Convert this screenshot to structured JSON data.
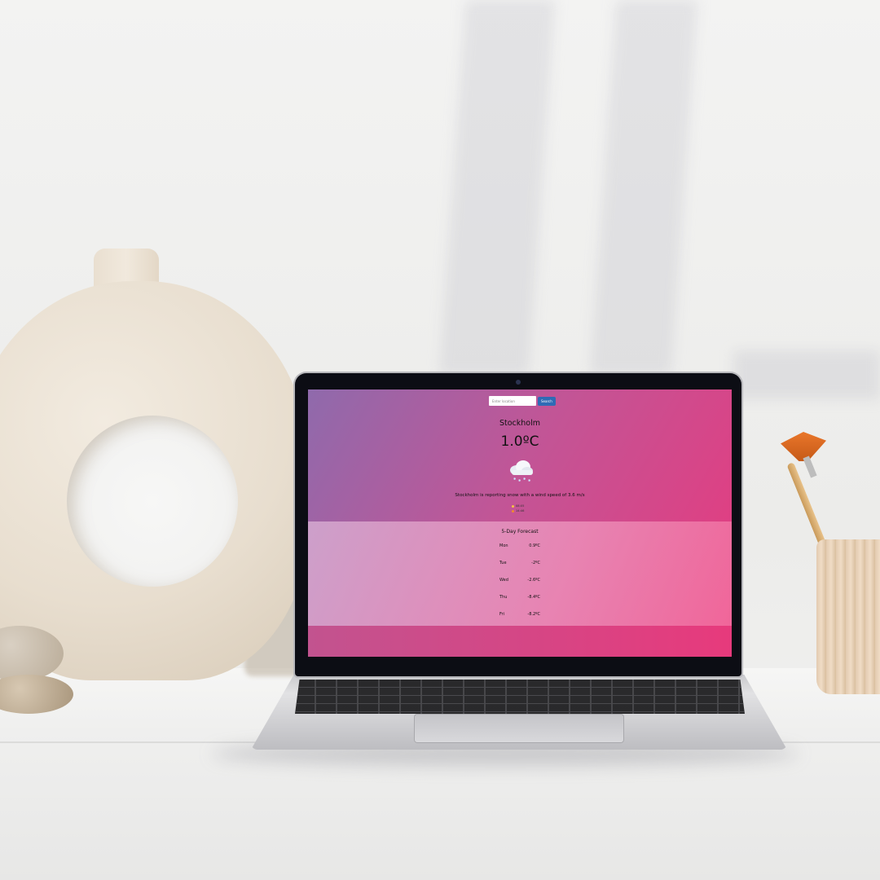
{
  "search": {
    "placeholder": "Enter location",
    "button_label": "Search"
  },
  "current": {
    "city": "Stockholm",
    "temperature": "1.0ºC",
    "condition_icon": "snow-cloud-icon",
    "description": "Stockholm is reporting snow with a wind speed of 3.6 m/s",
    "sunrise": "08:05",
    "sunset": "14:46"
  },
  "forecast": {
    "title": "5-Day Forecast",
    "days": [
      {
        "day": "Mon",
        "temp": "0.9ºC"
      },
      {
        "day": "Tue",
        "temp": "-2ºC"
      },
      {
        "day": "Wed",
        "temp": "-2.6ºC"
      },
      {
        "day": "Thu",
        "temp": "-8.4ºC"
      },
      {
        "day": "Fri",
        "temp": "-8.2ºC"
      }
    ]
  },
  "colors": {
    "gradient_start": "#8f6aac",
    "gradient_end": "#e8397d",
    "search_button": "#2f6bb5"
  }
}
